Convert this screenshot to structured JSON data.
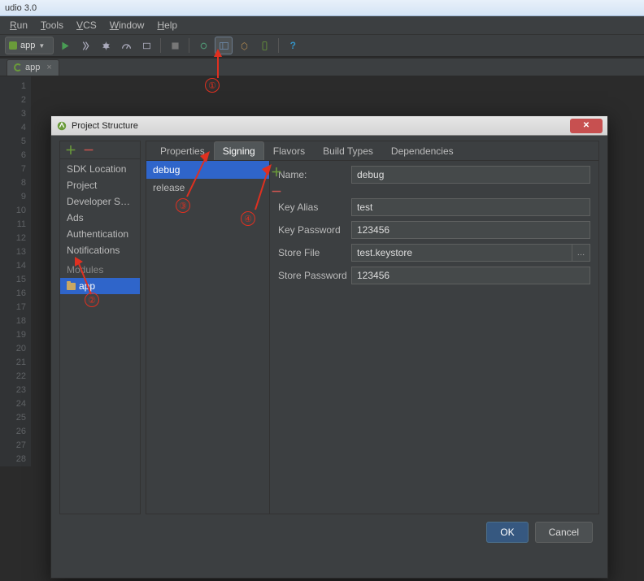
{
  "window_title": "udio 3.0",
  "menu": {
    "run": "Run",
    "tools": "Tools",
    "vcs": "VCS",
    "window": "Window",
    "help": "Help"
  },
  "toolbar": {
    "config_label": "app",
    "config_caret": "▼"
  },
  "editor_tabs": [
    {
      "label": "app"
    }
  ],
  "gutter_start": 1,
  "gutter_end": 28,
  "dialog": {
    "title": "Project Structure",
    "left_items": {
      "sdk": "SDK Location",
      "project": "Project",
      "devser": "Developer Ser...",
      "ads": "Ads",
      "auth": "Authentication",
      "notif": "Notifications"
    },
    "modules_heading": "Modules",
    "selected_module": "app",
    "tabs": {
      "properties": "Properties",
      "signing": "Signing",
      "flavors": "Flavors",
      "buildtypes": "Build Types",
      "dependencies": "Dependencies"
    },
    "configs": {
      "debug": "debug",
      "release": "release"
    },
    "form": {
      "name_label": "Name:",
      "name_value": "debug",
      "keyalias_label": "Key Alias",
      "keyalias_value": "test",
      "keypassword_label": "Key Password",
      "keypassword_value": "123456",
      "storefile_label": "Store File",
      "storefile_value": "test.keystore",
      "storepassword_label": "Store Password",
      "storepassword_value": "123456"
    },
    "buttons": {
      "ok": "OK",
      "cancel": "Cancel"
    }
  },
  "annotations": {
    "a1": "①",
    "a2": "②",
    "a3": "③",
    "a4": "④"
  }
}
